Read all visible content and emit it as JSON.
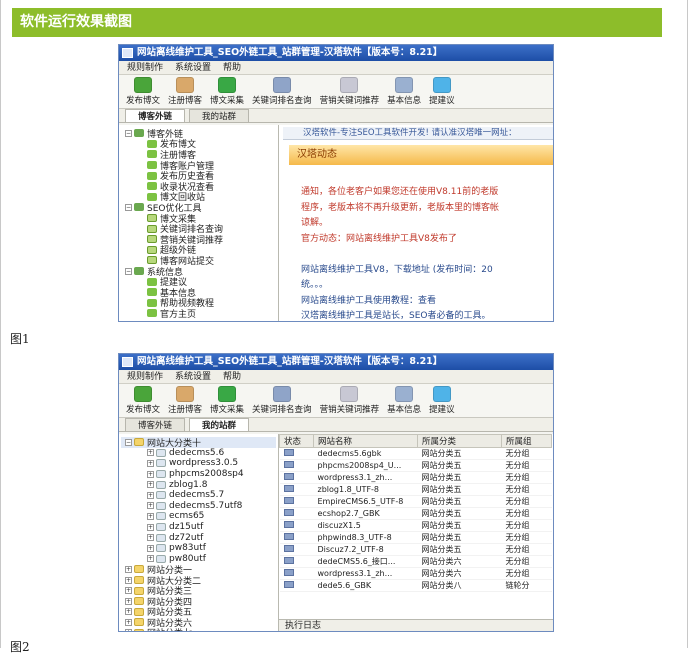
{
  "header": {
    "title": "软件运行效果截图"
  },
  "captions": {
    "fig1": "图1",
    "fig2": "图2"
  },
  "app": {
    "title": "网站离线维护工具_SEO外链工具_站群管理-汉塔软件【版本号：8.21】",
    "menu": [
      "规则制作",
      "系统设置",
      "帮助"
    ],
    "toolbar": [
      {
        "label": "发布博文",
        "icon": "refresh-icon",
        "color": "#4aa53a"
      },
      {
        "label": "注册博客",
        "icon": "clipboard-icon",
        "color": "#d9a86a"
      },
      {
        "label": "博文采集",
        "icon": "check-icon",
        "color": "#39a845"
      },
      {
        "label": "关键词排名查询",
        "icon": "magnifier-doc-icon",
        "color": "#8fa4c8"
      },
      {
        "label": "营销关键词推荐",
        "icon": "table-icon",
        "color": "#c8c8d4"
      },
      {
        "label": "基本信息",
        "icon": "screen-icon",
        "color": "#9ab0d0"
      },
      {
        "label": "提建议",
        "icon": "chat-icon",
        "color": "#4fb3e8"
      }
    ],
    "tabs": [
      "博客外链",
      "我的站群"
    ]
  },
  "fig1": {
    "tree": [
      {
        "label": "博客外链",
        "level": 0,
        "icon": "feed",
        "exp": "−"
      },
      {
        "label": "发布博文",
        "level": 1,
        "icon": "leaf"
      },
      {
        "label": "注册博客",
        "level": 1,
        "icon": "leaf"
      },
      {
        "label": "博客账户管理",
        "level": 1,
        "icon": "leaf"
      },
      {
        "label": "发布历史查看",
        "level": 1,
        "icon": "leaf"
      },
      {
        "label": "收录状况查看",
        "level": 1,
        "icon": "leaf"
      },
      {
        "label": "博文回收站",
        "level": 1,
        "icon": "leaf"
      },
      {
        "label": "SEO优化工具",
        "level": 0,
        "icon": "feed",
        "exp": "−"
      },
      {
        "label": "博文采集",
        "level": 1,
        "icon": "doc"
      },
      {
        "label": "关键词排名查询",
        "level": 1,
        "icon": "doc"
      },
      {
        "label": "营销关键词推荐",
        "level": 1,
        "icon": "doc"
      },
      {
        "label": "超级外链",
        "level": 1,
        "icon": "doc"
      },
      {
        "label": "博客网站提交",
        "level": 1,
        "icon": "doc"
      },
      {
        "label": "系统信息",
        "level": 0,
        "icon": "feed",
        "exp": "−"
      },
      {
        "label": "提建议",
        "level": 1,
        "icon": "leaf"
      },
      {
        "label": "基本信息",
        "level": 1,
        "icon": "leaf"
      },
      {
        "label": "帮助视频教程",
        "level": 1,
        "icon": "leaf"
      },
      {
        "label": "官方主页",
        "level": 1,
        "icon": "leaf"
      }
    ],
    "notice": "汉塔软件-专注SEO工具软件开发! 请认准汉塔唯一网址：",
    "news_title": "汉塔动态",
    "news": [
      {
        "text": "通知，各位老客户如果您还在使用V8.11前的老版",
        "cls": "red"
      },
      {
        "text": "程序，老版本将不再升级更新，老版本里的博客帐",
        "cls": "red"
      },
      {
        "text": "谅解。",
        "cls": "red"
      },
      {
        "text": "官方动态：网站离线维护工具V8发布了",
        "cls": "red"
      },
      {
        "text": "",
        "cls": "red"
      },
      {
        "text": "网站离线维护工具V8，下载地址 (发布时间：20",
        "cls": "blue"
      },
      {
        "text": "统。。。",
        "cls": "blue"
      },
      {
        "text": "网站离线维护工具使用教程：查看",
        "cls": "blue"
      },
      {
        "text": "汉塔离线维护工具是站长，SEO者必备的工具。",
        "cls": "blue"
      }
    ]
  },
  "fig2": {
    "tree": [
      {
        "label": "网站大分类十",
        "level": 0,
        "icon": "folder",
        "exp": "−",
        "sel": true
      },
      {
        "label": "dedecms5.6",
        "level": 1,
        "icon": "file",
        "exp": "+"
      },
      {
        "label": "wordpress3.0.5",
        "level": 1,
        "icon": "file",
        "exp": "+"
      },
      {
        "label": "phpcms2008sp4",
        "level": 1,
        "icon": "file",
        "exp": "+"
      },
      {
        "label": "zblog1.8",
        "level": 1,
        "icon": "file",
        "exp": "+"
      },
      {
        "label": "dedecms5.7",
        "level": 1,
        "icon": "file",
        "exp": "+"
      },
      {
        "label": "dedecms5.7utf8",
        "level": 1,
        "icon": "file",
        "exp": "+"
      },
      {
        "label": "ecms65",
        "level": 1,
        "icon": "file",
        "exp": "+"
      },
      {
        "label": "dz15utf",
        "level": 1,
        "icon": "file",
        "exp": "+"
      },
      {
        "label": "dz72utf",
        "level": 1,
        "icon": "file",
        "exp": "+"
      },
      {
        "label": "pw83utf",
        "level": 1,
        "icon": "file",
        "exp": "+"
      },
      {
        "label": "pw80utf",
        "level": 1,
        "icon": "file",
        "exp": "+"
      },
      {
        "label": "网站分类一",
        "level": 0,
        "icon": "folder",
        "exp": "+"
      },
      {
        "label": "网站大分类二",
        "level": 0,
        "icon": "folder",
        "exp": "+"
      },
      {
        "label": "网站分类三",
        "level": 0,
        "icon": "folder",
        "exp": "+"
      },
      {
        "label": "网站分类四",
        "level": 0,
        "icon": "folder",
        "exp": "+"
      },
      {
        "label": "网站分类五",
        "level": 0,
        "icon": "folder",
        "exp": "+"
      },
      {
        "label": "网站分类六",
        "level": 0,
        "icon": "folder",
        "exp": "+"
      },
      {
        "label": "网站分类七",
        "level": 0,
        "icon": "folder",
        "exp": "+"
      },
      {
        "label": "网站分类八",
        "level": 0,
        "icon": "folder",
        "exp": "+"
      }
    ],
    "columns": [
      "状态",
      "网站名称",
      "所属分类",
      "所属组"
    ],
    "rows": [
      [
        "dedecms5.6gbk",
        "网站分类五",
        "无分组"
      ],
      [
        "phpcms2008sp4_U...",
        "网站分类五",
        "无分组"
      ],
      [
        "wordpress3.1_zh...",
        "网站分类五",
        "无分组"
      ],
      [
        "zblog1.8_UTF-8",
        "网站分类五",
        "无分组"
      ],
      [
        "EmpireCMS6.5_UTF-8",
        "网站分类五",
        "无分组"
      ],
      [
        "ecshop2.7_GBK",
        "网站分类五",
        "无分组"
      ],
      [
        "discuzX1.5",
        "网站分类五",
        "无分组"
      ],
      [
        "phpwind8.3_UTF-8",
        "网站分类五",
        "无分组"
      ],
      [
        "Discuz7.2_UTF-8",
        "网站分类五",
        "无分组"
      ],
      [
        "dedeCMS5.6_接口...",
        "网站分类六",
        "无分组"
      ],
      [
        "wordpress3.1_zh...",
        "网站分类六",
        "无分组"
      ],
      [
        "dede5.6_GBK",
        "网站分类八",
        "链轮分"
      ]
    ],
    "log_label": "执行日志"
  }
}
